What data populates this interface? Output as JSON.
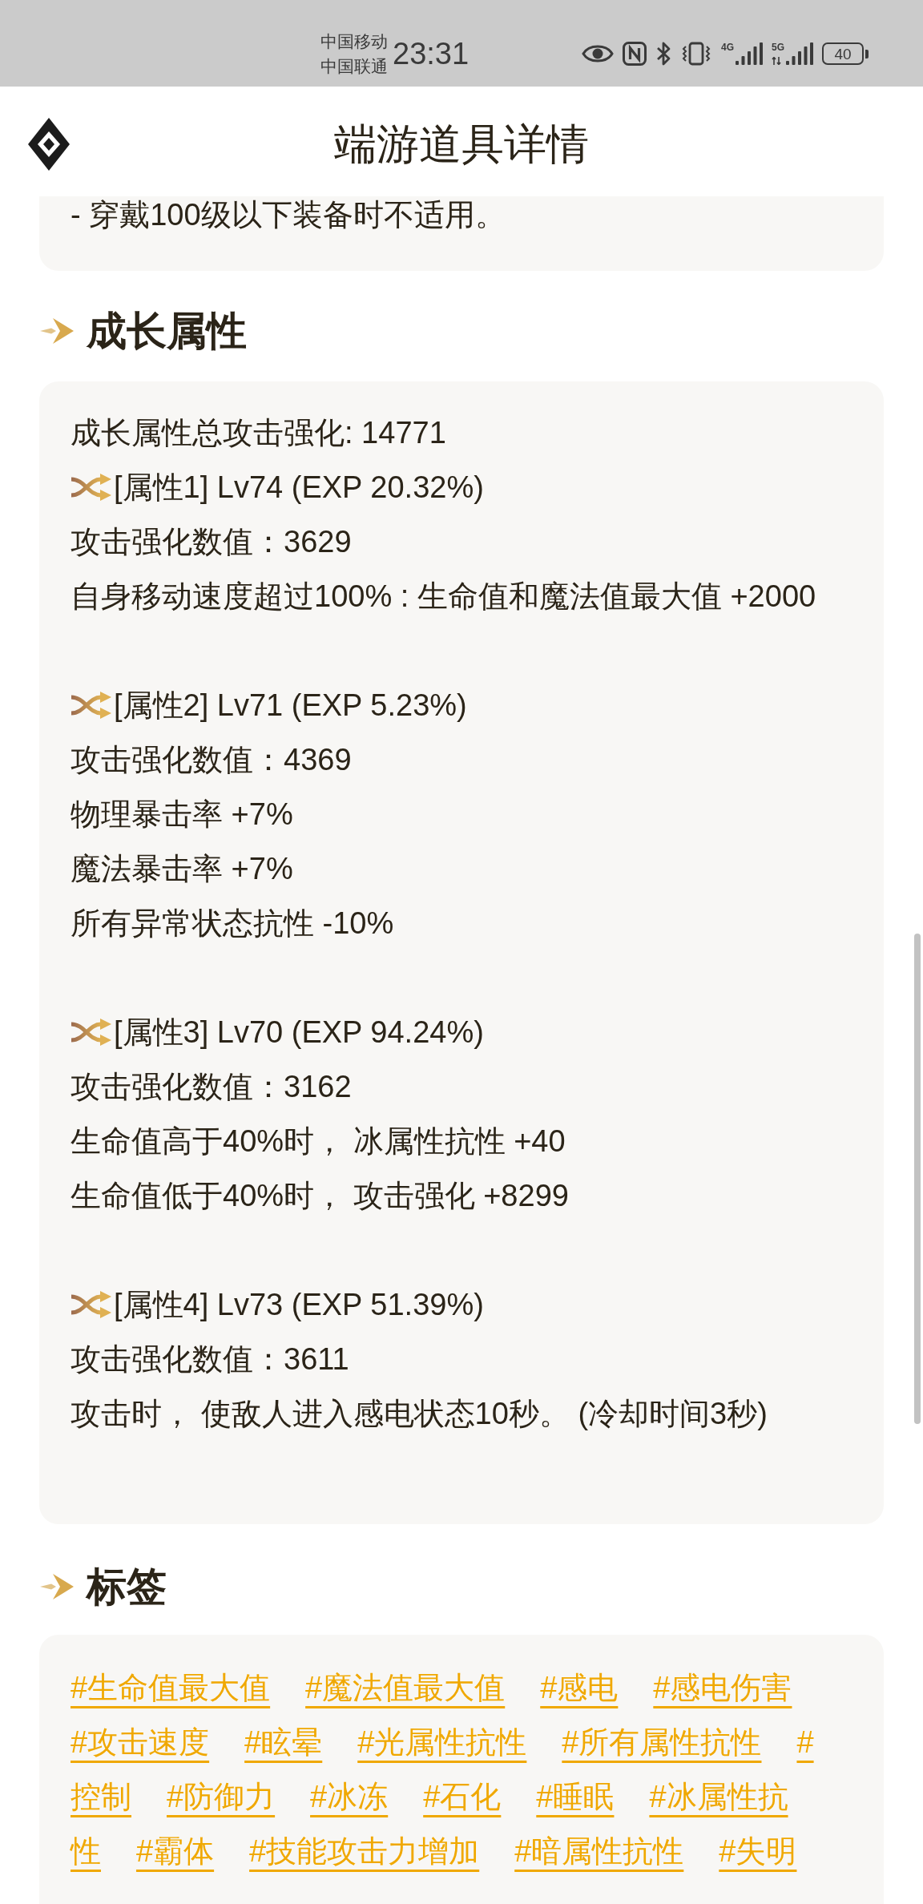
{
  "status_bar": {
    "carriers": [
      "中国移动",
      "中国联通"
    ],
    "time": "23:31",
    "signals": [
      {
        "label": "4G",
        "arrows": false
      },
      {
        "label": "5G",
        "arrows": true
      }
    ],
    "battery": "40"
  },
  "header": {
    "title": "端游道具详情"
  },
  "note_card": {
    "lines": [
      "- 穿戴100级以下装备时不适用。"
    ]
  },
  "growth": {
    "title": "成长属性",
    "total": "成长属性总攻击强化: 14771",
    "attributes": [
      {
        "header": "[属性1] Lv74 (EXP 20.32%)",
        "lines": [
          "攻击强化数值：3629",
          "自身移动速度超过100% : 生命值和魔法值最大值 +2000"
        ]
      },
      {
        "header": "[属性2] Lv71 (EXP 5.23%)",
        "lines": [
          "攻击强化数值：4369",
          "物理暴击率 +7%",
          "魔法暴击率 +7%",
          "所有异常状态抗性 -10%"
        ]
      },
      {
        "header": "[属性3] Lv70 (EXP 94.24%)",
        "lines": [
          "攻击强化数值：3162",
          "生命值高于40%时， 冰属性抗性 +40",
          "生命值低于40%时， 攻击强化 +8299"
        ]
      },
      {
        "header": "[属性4] Lv73 (EXP 51.39%)",
        "lines": [
          "攻击强化数值：3611",
          "攻击时， 使敌人进入感电状态10秒。 (冷却时间3秒)"
        ]
      }
    ]
  },
  "tags": {
    "title": "标签",
    "items": [
      {
        "lines": [
          "#生命值最大值"
        ]
      },
      {
        "lines": [
          "#魔法值最大值"
        ]
      },
      {
        "lines": [
          "#感电"
        ]
      },
      {
        "lines": [
          "#感电伤害"
        ]
      },
      {
        "lines": [
          "#攻击速度"
        ]
      },
      {
        "lines": [
          "#眩晕"
        ]
      },
      {
        "lines": [
          "#光属性抗性"
        ]
      },
      {
        "lines": [
          "#所有属性抗性"
        ]
      },
      {
        "lines": [
          "#",
          "控制"
        ]
      },
      {
        "lines": [
          "#防御力"
        ]
      },
      {
        "lines": [
          "#冰冻"
        ]
      },
      {
        "lines": [
          "#石化"
        ]
      },
      {
        "lines": [
          "#睡眠"
        ]
      },
      {
        "lines": [
          "#冰属性抗",
          "性"
        ]
      },
      {
        "lines": [
          "#霸体"
        ]
      },
      {
        "lines": [
          "#技能攻击力增加"
        ]
      },
      {
        "lines": [
          "#暗属性抗性"
        ]
      },
      {
        "lines": [
          "#失明"
        ]
      }
    ]
  }
}
